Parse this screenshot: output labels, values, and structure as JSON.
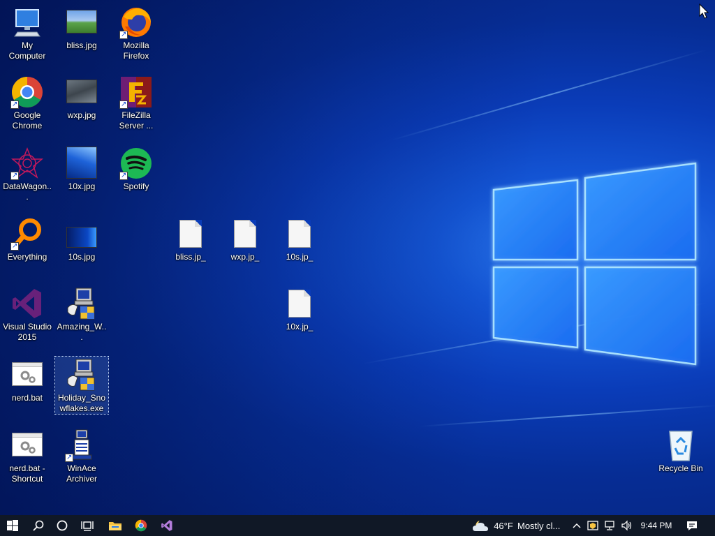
{
  "desktop": {
    "icons": [
      {
        "label": "My Computer"
      },
      {
        "label": "bliss.jpg"
      },
      {
        "label": "Mozilla Firefox"
      },
      {
        "label": "Google Chrome"
      },
      {
        "label": "wxp.jpg"
      },
      {
        "label": "FileZilla Server ..."
      },
      {
        "label": "DataWagon..."
      },
      {
        "label": "10x.jpg"
      },
      {
        "label": "Spotify"
      },
      {
        "label": "Everything"
      },
      {
        "label": "10s.jpg"
      },
      {
        "label": "bliss.jp_"
      },
      {
        "label": "wxp.jp_"
      },
      {
        "label": "10s.jp_"
      },
      {
        "label": "Visual Studio 2015"
      },
      {
        "label": "Amazing_W..."
      },
      {
        "label": "10x.jp_"
      },
      {
        "label": "nerd.bat"
      },
      {
        "label": "Holiday_Snowflakes.exe"
      },
      {
        "label": "nerd.bat - Shortcut"
      },
      {
        "label": "WinAce Archiver"
      },
      {
        "label": "Recycle Bin"
      }
    ]
  },
  "taskbar": {
    "weather_temp": "46°F",
    "weather_text": "Mostly cl...",
    "time": "9:44 PM",
    "pinned": [
      "start-icon",
      "search-icon",
      "cortana-icon",
      "task-view-icon",
      "file-explorer-icon",
      "chrome-icon",
      "visual-studio-icon"
    ],
    "tray": [
      "chevron-up-icon",
      "security-icon",
      "network-icon",
      "volume-icon",
      "notification-icon"
    ]
  },
  "colors": {
    "taskbar_bg": "#101826",
    "desktop_blue": "#0a3cb8",
    "logo_glow": "#7fd0ff"
  }
}
